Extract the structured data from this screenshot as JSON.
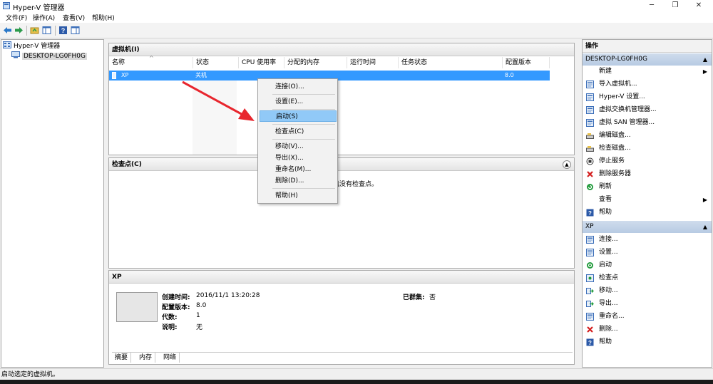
{
  "window": {
    "title": "Hyper-V 管理器",
    "minimize_glyph": "─",
    "restore_glyph": "❐",
    "close_glyph": "✕"
  },
  "menu": [
    "文件(F)",
    "操作(A)",
    "查看(V)",
    "帮助(H)"
  ],
  "tree": {
    "root": "Hyper-V 管理器",
    "child": "DESKTOP-LG0FH0G"
  },
  "vm_pane": {
    "title": "虚拟机(I)",
    "columns": [
      "名称",
      "状态",
      "CPU 使用率",
      "分配的内存",
      "运行时间",
      "任务状态",
      "配置版本"
    ],
    "row": {
      "name": "XP",
      "state": "关机",
      "version": "8.0"
    }
  },
  "checkpoint_pane": {
    "title": "检查点(C)",
    "message_fragment": "机没有检查点。"
  },
  "details_pane": {
    "title": "XP",
    "created_label": "创建时间:",
    "created_value": "2016/11/1 13:20:28",
    "version_label": "配置版本:",
    "version_value": "8.0",
    "gen_label": "代数:",
    "gen_value": "1",
    "desc_label": "说明:",
    "desc_value": "无",
    "cluster_label": "已群集:",
    "cluster_value": "否",
    "tabs": [
      "摘要",
      "内存",
      "网络"
    ]
  },
  "context_menu": [
    "连接(O)...",
    "设置(E)...",
    "启动(S)",
    "检查点(C)",
    "移动(V)...",
    "导出(X)...",
    "重命名(M)...",
    "删除(D)...",
    "帮助(H)"
  ],
  "actions": {
    "title": "操作",
    "host_section": "DESKTOP-LG0FH0G",
    "host_items": [
      "新建",
      "导入虚拟机...",
      "Hyper-V 设置...",
      "虚拟交换机管理器...",
      "虚拟 SAN 管理器...",
      "编辑磁盘...",
      "检查磁盘...",
      "停止服务",
      "删除服务器",
      "刷新",
      "查看",
      "帮助"
    ],
    "vm_section": "XP",
    "vm_items": [
      "连接...",
      "设置...",
      "启动",
      "检查点",
      "移动...",
      "导出...",
      "重命名...",
      "删除...",
      "帮助"
    ]
  },
  "status": "启动选定的虚拟机。",
  "colors": {
    "selection": "#3399ff",
    "highlight": "#91c9f7",
    "arrow": "#e8262e"
  }
}
